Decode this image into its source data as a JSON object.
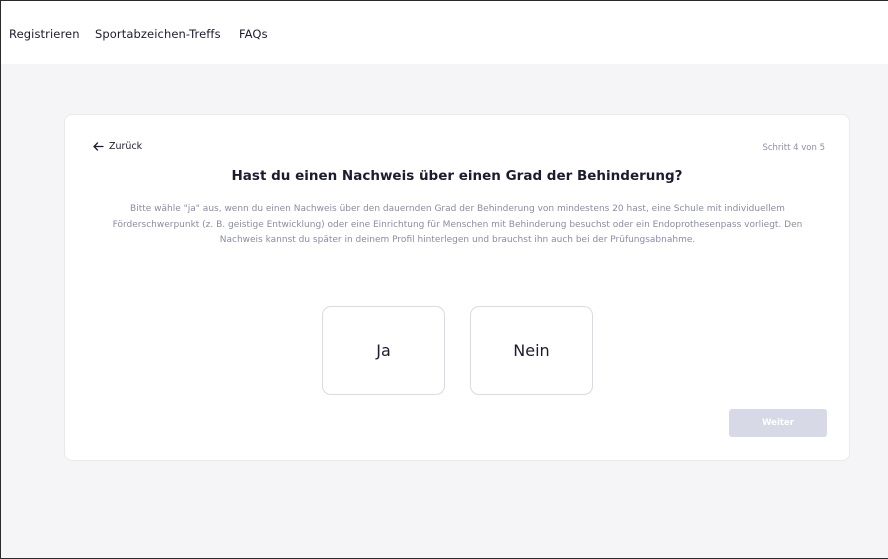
{
  "nav": {
    "items": [
      "Registrieren",
      "Sportabzeichen-Treffs",
      "FAQs"
    ]
  },
  "card": {
    "back_label": "Zurück",
    "step": "Schritt 4 von 5",
    "question": "Hast du einen Nachweis über einen Grad der Behinderung?",
    "description": "Bitte wähle \"ja\" aus, wenn du einen Nachweis über den dauernden Grad der Behinderung von mindestens 20 hast, eine Schule mit individuellem Förderschwerpunkt (z. B. geistige Entwicklung) oder eine Einrichtung für Menschen mit Behinderung besuchst oder ein Endoprothesenpass vorliegt. Den Nachweis kannst du später in deinem Profil hinterlegen und brauchst ihn auch bei der Prüfungsabnahme.",
    "options": [
      "Ja",
      "Nein"
    ],
    "next_label": "Weiter"
  },
  "icons": {
    "back": "arrow-left-icon"
  },
  "colors": {
    "text": "#1b1d2e",
    "muted": "#8a8ca3",
    "page_bg": "#f5f5f8",
    "button_disabled": "#d8d9e6"
  }
}
